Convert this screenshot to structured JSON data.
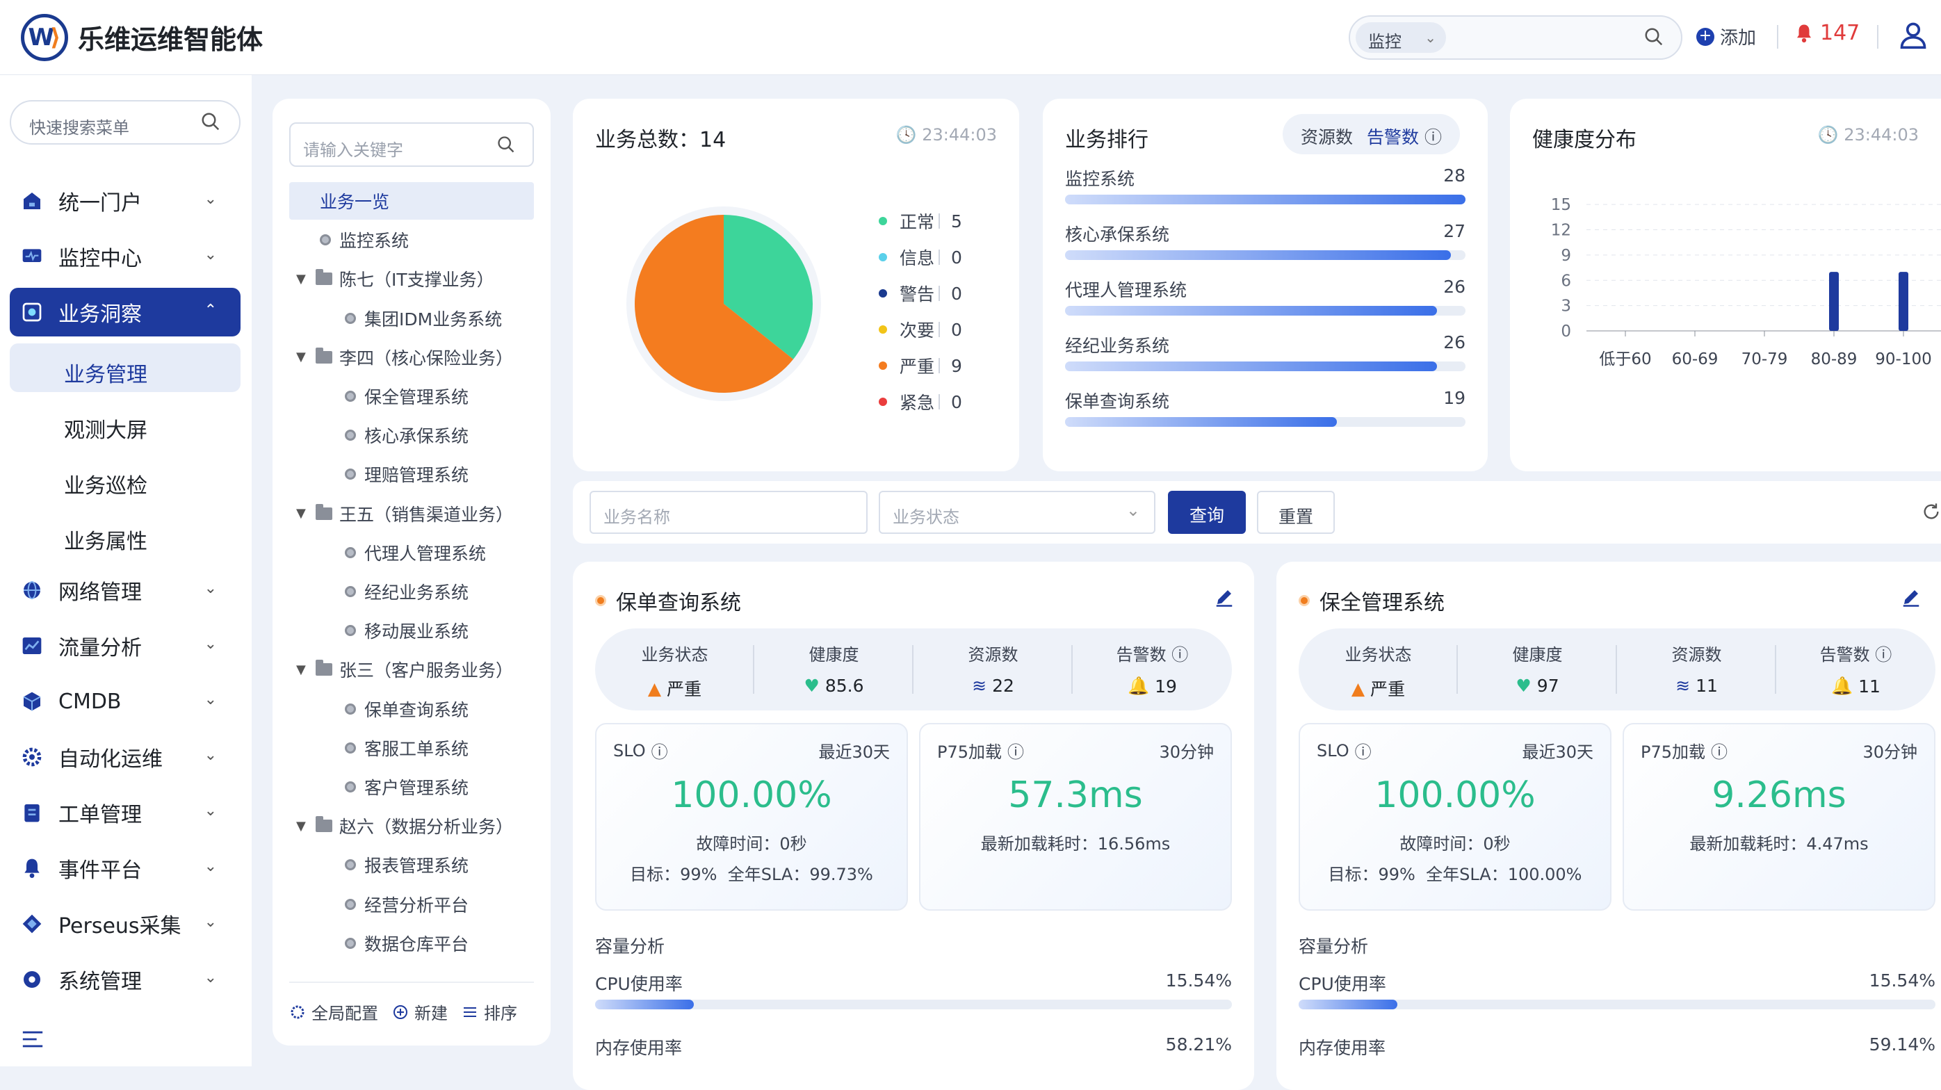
{
  "app": {
    "title": "乐维运维智能体",
    "logo_letter": "W"
  },
  "topbar": {
    "scope_label": "监控",
    "add_label": "添加",
    "alarm_count": "147"
  },
  "sidebar": {
    "search_placeholder": "快速搜索菜单",
    "items": [
      {
        "label": "统一门户",
        "icon": "portal-icon"
      },
      {
        "label": "监控中心",
        "icon": "monitor-icon"
      },
      {
        "label": "业务洞察",
        "icon": "insight-icon",
        "active": true
      },
      {
        "label": "网络管理",
        "icon": "globe-icon"
      },
      {
        "label": "流量分析",
        "icon": "traffic-chart-icon"
      },
      {
        "label": "CMDB",
        "icon": "cube-icon"
      },
      {
        "label": "自动化运维",
        "icon": "automation-gear-icon"
      },
      {
        "label": "工单管理",
        "icon": "ticket-icon"
      },
      {
        "label": "事件平台",
        "icon": "bell-icon"
      },
      {
        "label": "Perseus采集",
        "icon": "collector-icon"
      },
      {
        "label": "系统管理",
        "icon": "settings-icon"
      }
    ],
    "submenu": [
      {
        "label": "业务管理",
        "active": true
      },
      {
        "label": "观测大屏"
      },
      {
        "label": "业务巡检"
      },
      {
        "label": "业务属性"
      }
    ]
  },
  "tree": {
    "search_placeholder": "请输入关键字",
    "rows": [
      {
        "label": "业务一览",
        "type": "root",
        "active": true
      },
      {
        "label": "监控系统",
        "type": "leaf1"
      },
      {
        "label": "陈七（IT支撑业务）",
        "type": "group"
      },
      {
        "label": "集团IDM业务系统",
        "type": "leaf"
      },
      {
        "label": "李四（核心保险业务）",
        "type": "group"
      },
      {
        "label": "保全管理系统",
        "type": "leaf"
      },
      {
        "label": "核心承保系统",
        "type": "leaf"
      },
      {
        "label": "理赔管理系统",
        "type": "leaf"
      },
      {
        "label": "王五（销售渠道业务）",
        "type": "group"
      },
      {
        "label": "代理人管理系统",
        "type": "leaf"
      },
      {
        "label": "经纪业务系统",
        "type": "leaf"
      },
      {
        "label": "移动展业系统",
        "type": "leaf"
      },
      {
        "label": "张三（客户服务业务）",
        "type": "group"
      },
      {
        "label": "保单查询系统",
        "type": "leaf"
      },
      {
        "label": "客服工单系统",
        "type": "leaf"
      },
      {
        "label": "客户管理系统",
        "type": "leaf"
      },
      {
        "label": "赵六（数据分析业务）",
        "type": "group"
      },
      {
        "label": "报表管理系统",
        "type": "leaf"
      },
      {
        "label": "经营分析平台",
        "type": "leaf"
      },
      {
        "label": "数据仓库平台",
        "type": "leaf"
      }
    ],
    "footer": {
      "config": "全局配置",
      "new": "新建",
      "sort": "排序"
    }
  },
  "total_card": {
    "title": "业务总数：14",
    "time": "23:44:03",
    "legend": [
      {
        "label": "正常",
        "value": "5",
        "color": "#3dd59a"
      },
      {
        "label": "信息",
        "value": "0",
        "color": "#5ad0ea"
      },
      {
        "label": "警告",
        "value": "0",
        "color": "#1a3a8f"
      },
      {
        "label": "次要",
        "value": "0",
        "color": "#f2c418"
      },
      {
        "label": "严重",
        "value": "9",
        "color": "#f47c1f"
      },
      {
        "label": "紧急",
        "value": "0",
        "color": "#ea3d3d"
      }
    ]
  },
  "rank_card": {
    "title": "业务排行",
    "tab_resources": "资源数",
    "tab_alarms": "告警数",
    "rows": [
      {
        "name": "监控系统",
        "value": "28",
        "ratio": 1.0
      },
      {
        "name": "核心承保系统",
        "value": "27",
        "ratio": 0.964
      },
      {
        "name": "代理人管理系统",
        "value": "26",
        "ratio": 0.929
      },
      {
        "name": "经纪业务系统",
        "value": "26",
        "ratio": 0.929
      },
      {
        "name": "保单查询系统",
        "value": "19",
        "ratio": 0.679
      }
    ]
  },
  "health_card": {
    "title": "健康度分布",
    "time": "23:44:03"
  },
  "chart_data": {
    "type": "bar",
    "title": "健康度分布",
    "categories": [
      "低于60",
      "60-69",
      "70-79",
      "80-89",
      "90-100"
    ],
    "values": [
      0,
      0,
      0,
      7,
      7
    ],
    "yticks": [
      0,
      3,
      6,
      9,
      12,
      15
    ],
    "ylim": [
      0,
      16
    ],
    "grid": true,
    "xlabel": "",
    "ylabel": ""
  },
  "filter": {
    "name_placeholder": "业务名称",
    "status_placeholder": "业务状态",
    "query_label": "查询",
    "reset_label": "重置"
  },
  "systems": [
    {
      "name": "保单查询系统",
      "stat_labels": {
        "status": "业务状态",
        "health": "健康度",
        "resources": "资源数",
        "alarms": "告警数"
      },
      "status": "严重",
      "health": "85.6",
      "resources": "22",
      "alarms": "19",
      "slo": {
        "label": "SLO",
        "period": "最近30天",
        "value": "100.00%",
        "downtime": "故障时间：0秒",
        "target": "目标：99%",
        "sla": "全年SLA：99.73%"
      },
      "p75": {
        "label": "P75加载",
        "period": "30分钟",
        "value": "57.3ms",
        "latest": "最新加载耗时：16.56ms"
      },
      "capacity": {
        "title": "容量分析",
        "cpu_label": "CPU使用率",
        "cpu": "15.54%",
        "cpu_ratio": 0.1554,
        "mem_label": "内存使用率",
        "mem": "58.21%"
      }
    },
    {
      "name": "保全管理系统",
      "stat_labels": {
        "status": "业务状态",
        "health": "健康度",
        "resources": "资源数",
        "alarms": "告警数"
      },
      "status": "严重",
      "health": "97",
      "resources": "11",
      "alarms": "11",
      "slo": {
        "label": "SLO",
        "period": "最近30天",
        "value": "100.00%",
        "downtime": "故障时间：0秒",
        "target": "目标：99%",
        "sla": "全年SLA：100.00%"
      },
      "p75": {
        "label": "P75加载",
        "period": "30分钟",
        "value": "9.26ms",
        "latest": "最新加载耗时：4.47ms"
      },
      "capacity": {
        "title": "容量分析",
        "cpu_label": "CPU使用率",
        "cpu": "15.54%",
        "cpu_ratio": 0.1554,
        "mem_label": "内存使用率",
        "mem": "59.14%"
      }
    }
  ]
}
